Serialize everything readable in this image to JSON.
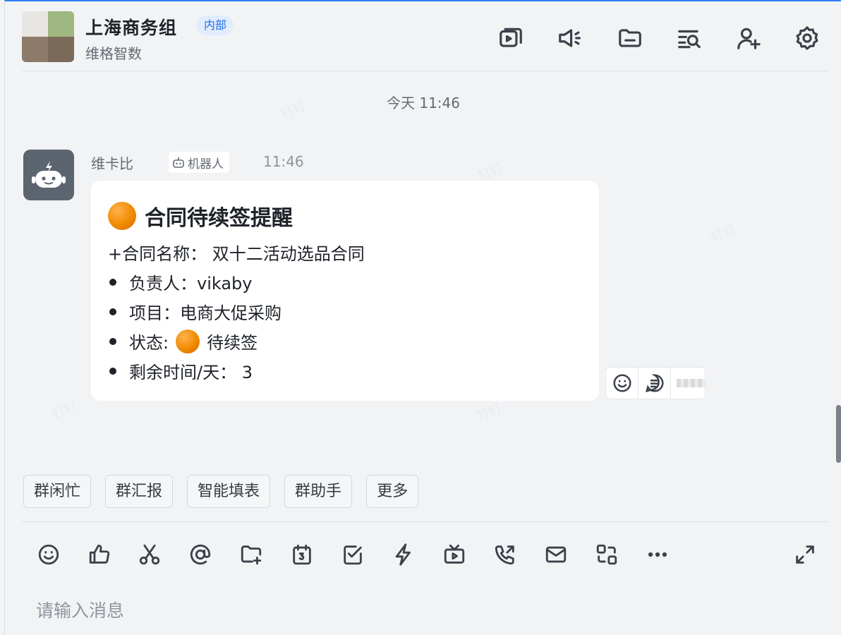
{
  "header": {
    "group_name": "上海商务组",
    "group_tag": "内部",
    "organization": "维格智数",
    "icons": [
      "video-meeting-icon",
      "announcement-icon",
      "folder-icon",
      "search-history-icon",
      "add-member-icon",
      "settings-icon"
    ]
  },
  "chat": {
    "day_stamp": "今天 11:46",
    "message": {
      "sender": "维卡比",
      "badge": "机器人",
      "time": "11:46",
      "card": {
        "title": "合同待续签提醒",
        "contract_line": "+合同名称： 双十二活动选品合同",
        "owner_line": "负责人：vikaby",
        "project_line": "项目：电商大促采购",
        "status_label": "状态:",
        "status_value": "待续签",
        "remaining_line": "剩余时间/天： 3"
      }
    },
    "watermark_text": "钉钉"
  },
  "quick_apps": [
    "群闲忙",
    "群汇报",
    "智能填表",
    "群助手",
    "更多"
  ],
  "toolbar": {
    "icons": [
      "emoji-icon",
      "like-icon",
      "screenshot-icon",
      "mention-icon",
      "send-file-icon",
      "calendar-icon",
      "todo-icon",
      "ding-icon",
      "live-icon",
      "call-icon",
      "mail-icon",
      "share-screen-icon",
      "more-icon",
      "expand-icon"
    ]
  },
  "input": {
    "placeholder": "请输入消息"
  },
  "colors": {
    "accent": "#2e7cf6",
    "tag_bg": "#e1ecfd",
    "tag_text": "#1f6fe5",
    "status_orange": "#f08a00",
    "background": "#f2f3f5"
  }
}
